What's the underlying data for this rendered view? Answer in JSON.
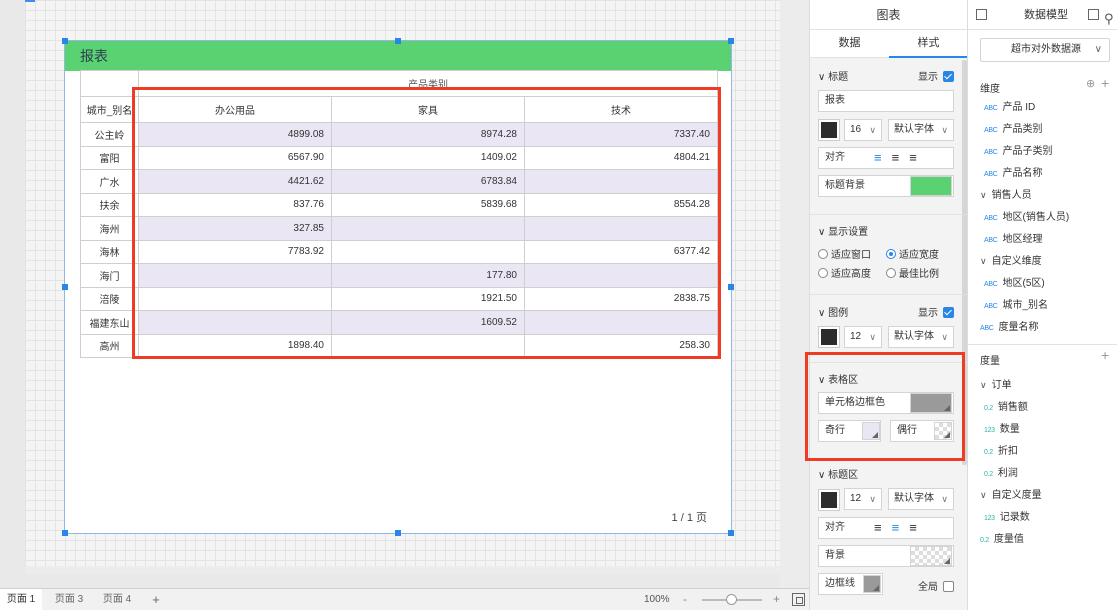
{
  "widget": {
    "title": "报表",
    "pager": "1 / 1 页",
    "table": {
      "group_header": "产品类别",
      "row_header": "城市_别名",
      "columns": [
        "办公用品",
        "家具",
        "技术"
      ],
      "rows": [
        {
          "name": "公主岭",
          "values": [
            "4899.08",
            "8974.28",
            "7337.40"
          ]
        },
        {
          "name": "富阳",
          "values": [
            "6567.90",
            "1409.02",
            "4804.21"
          ]
        },
        {
          "name": "广水",
          "values": [
            "4421.62",
            "6783.84",
            ""
          ]
        },
        {
          "name": "扶余",
          "values": [
            "837.76",
            "5839.68",
            "8554.28"
          ]
        },
        {
          "name": "海州",
          "values": [
            "327.85",
            "",
            ""
          ]
        },
        {
          "name": "海林",
          "values": [
            "7783.92",
            "",
            "6377.42"
          ]
        },
        {
          "name": "海门",
          "values": [
            "",
            "177.80",
            ""
          ]
        },
        {
          "name": "涪陵",
          "values": [
            "",
            "1921.50",
            "2838.75"
          ]
        },
        {
          "name": "福建东山",
          "values": [
            "",
            "1609.52",
            ""
          ]
        },
        {
          "name": "高州",
          "values": [
            "1898.40",
            "",
            "258.30"
          ]
        }
      ]
    }
  },
  "bottom_bar": {
    "pages": [
      "页面 1",
      "页面 3",
      "页面 4"
    ],
    "add": "+",
    "zoom": "100%",
    "zoom_minus": "-",
    "zoom_plus": "+"
  },
  "style_panel": {
    "header": "图表",
    "tabs": [
      "数据",
      "样式"
    ],
    "title_section": {
      "label": "标题",
      "show_label": "显示",
      "title_value": "报表",
      "font_size": "16",
      "font_family": "默认字体",
      "align_label": "对齐",
      "bg_label": "标题背景",
      "bg_color": "#5ad271"
    },
    "display_section": {
      "label": "显示设置",
      "options": [
        "适应窗口",
        "适应宽度",
        "适应高度",
        "最佳比例"
      ],
      "selected": "适应宽度"
    },
    "legend_section": {
      "label": "图例",
      "show_label": "显示",
      "font_size": "12",
      "font_family": "默认字体"
    },
    "table_section": {
      "label": "表格区",
      "border_color_label": "单元格边框色",
      "odd_label": "奇行",
      "even_label": "偶行",
      "border_color": "#9a9a9a",
      "odd_color": "#ebe6f4"
    },
    "title_area_section": {
      "label": "标题区",
      "font_size": "12",
      "font_family": "默认字体",
      "align_label": "对齐",
      "bg_label": "背景",
      "border_label": "边框线",
      "global_label": "全局"
    }
  },
  "data_model": {
    "header": "数据模型",
    "datasource": "超市对外数据源",
    "dimensions_label": "维度",
    "dimensions": [
      {
        "icon": "ABC",
        "label": "产品 ID",
        "indent": 1
      },
      {
        "icon": "ABC",
        "label": "产品类别",
        "indent": 1
      },
      {
        "icon": "ABC",
        "label": "产品子类别",
        "indent": 1
      },
      {
        "icon": "ABC",
        "label": "产品名称",
        "indent": 1
      },
      {
        "icon": "caret",
        "label": "销售人员",
        "indent": 0
      },
      {
        "icon": "ABC",
        "label": "地区(销售人员)",
        "indent": 1
      },
      {
        "icon": "ABC",
        "label": "地区经理",
        "indent": 1
      },
      {
        "icon": "caret",
        "label": "自定义维度",
        "indent": 0
      },
      {
        "icon": "ABC",
        "label": "地区(5区)",
        "indent": 1
      },
      {
        "icon": "ABC",
        "label": "城市_别名",
        "indent": 1
      },
      {
        "icon": "ABC",
        "label": "度量名称",
        "indent": 0
      }
    ],
    "measures_label": "度量",
    "measures": [
      {
        "icon": "caret",
        "label": "订单",
        "indent": 0
      },
      {
        "icon": "0.2",
        "label": "销售额",
        "indent": 1
      },
      {
        "icon": "123",
        "label": "数量",
        "indent": 1
      },
      {
        "icon": "0.2",
        "label": "折扣",
        "indent": 1
      },
      {
        "icon": "0.2",
        "label": "利润",
        "indent": 1
      },
      {
        "icon": "caret",
        "label": "自定义度量",
        "indent": 0
      },
      {
        "icon": "123",
        "label": "记录数",
        "indent": 1
      },
      {
        "icon": "0.2",
        "label": "度量值",
        "indent": 0
      }
    ]
  }
}
